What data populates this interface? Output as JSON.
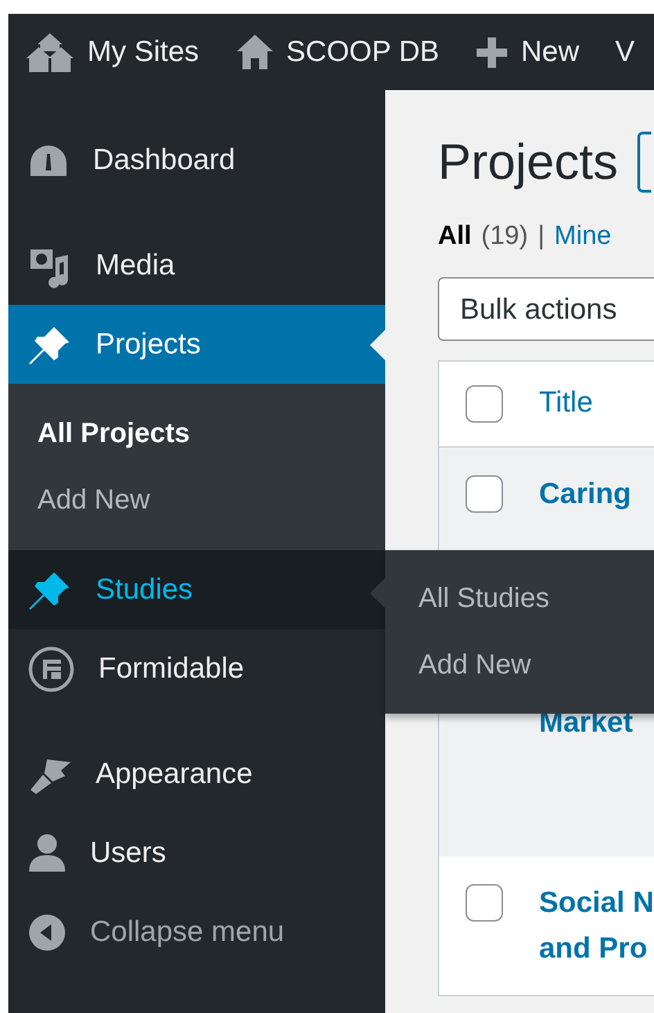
{
  "admin_bar": {
    "items": [
      {
        "kind": "sites",
        "label": "My Sites"
      },
      {
        "kind": "home",
        "label": "SCOOP DB"
      },
      {
        "kind": "new",
        "label": "New"
      },
      {
        "kind": "none",
        "label": "V"
      }
    ]
  },
  "sidebar": {
    "groups": [
      [
        {
          "kind": "dashboard",
          "label": "Dashboard",
          "selected": false,
          "hovered": false
        }
      ],
      [
        {
          "kind": "media",
          "label": "Media",
          "selected": false,
          "hovered": false
        },
        {
          "kind": "pin",
          "label": "Projects",
          "selected": true,
          "hovered": false,
          "submenu": [
            {
              "label": "All Projects",
              "selected": true
            },
            {
              "label": "Add New",
              "selected": false
            }
          ]
        },
        {
          "kind": "pin",
          "label": "Studies",
          "selected": false,
          "hovered": true,
          "flyout": [
            {
              "label": "All Studies"
            },
            {
              "label": "Add New"
            }
          ]
        },
        {
          "kind": "formidable",
          "label": "Formidable",
          "selected": false,
          "hovered": false
        }
      ],
      [
        {
          "kind": "brush",
          "label": "Appearance",
          "selected": false,
          "hovered": false
        },
        {
          "kind": "user",
          "label": "Users",
          "selected": false,
          "hovered": false
        }
      ]
    ],
    "collapse": {
      "label": "Collapse menu"
    }
  },
  "content": {
    "title": "Projects",
    "filters": [
      {
        "label": "All",
        "count": "(19)",
        "selected": true
      },
      {
        "separator": "|",
        "label": "Mine",
        "selected": false
      }
    ],
    "bulk_actions": "Bulk actions",
    "table": {
      "header": {
        "checked": false,
        "title": "Title"
      },
      "rows": [
        {
          "checked": false,
          "striped": true,
          "title_lines": [
            "Caring",
            "Market"
          ]
        },
        {
          "checked": false,
          "striped": false,
          "title_lines": [
            "Social N",
            "and Pro"
          ]
        }
      ]
    }
  }
}
